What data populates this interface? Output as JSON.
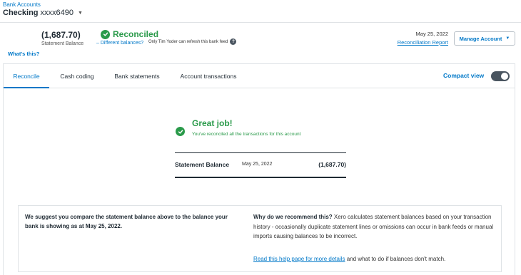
{
  "header": {
    "breadcrumb": "Bank Accounts",
    "account_name": "Checking",
    "account_number": "xxxx6490"
  },
  "summary": {
    "statement_balance": "(1,687.70)",
    "statement_balance_label": "Statement Balance",
    "whats_this": "What's this?",
    "status": "Reconciled",
    "different_balances": "– Different balances?",
    "refresh_note": "Only Tim Yoder can refresh this bank feed",
    "report_date": "May 25, 2022",
    "report_link": "Reconciliation Report",
    "manage_account": "Manage Account"
  },
  "tabs": [
    {
      "label": "Reconcile",
      "active": true
    },
    {
      "label": "Cash coding",
      "active": false
    },
    {
      "label": "Bank statements",
      "active": false
    },
    {
      "label": "Account transactions",
      "active": false
    }
  ],
  "compact_view": {
    "label": "Compact view",
    "enabled": true
  },
  "main": {
    "great_title": "Great job!",
    "great_sub": "You've reconciled all the transactions for this account",
    "statement_label": "Statement Balance",
    "statement_date": "May 25, 2022",
    "statement_amount": "(1,687.70)",
    "suggest_left": "We suggest you compare the statement balance above to the balance your bank is showing as at May 25, 2022.",
    "why_title": "Why do we recommend this?",
    "why_text": " Xero calculates statement balances based on your transaction history - occasionally duplicate statement lines or omissions can occur in bank feeds or manual imports causing balances to be incorrect.",
    "help_link": "Read this help page for more details",
    "help_suffix": " and what to do if balances don't match."
  },
  "colors": {
    "accent": "#0078c8",
    "success": "#2a9a4a",
    "text": "#1f2a33",
    "border": "#dfe3e6"
  }
}
